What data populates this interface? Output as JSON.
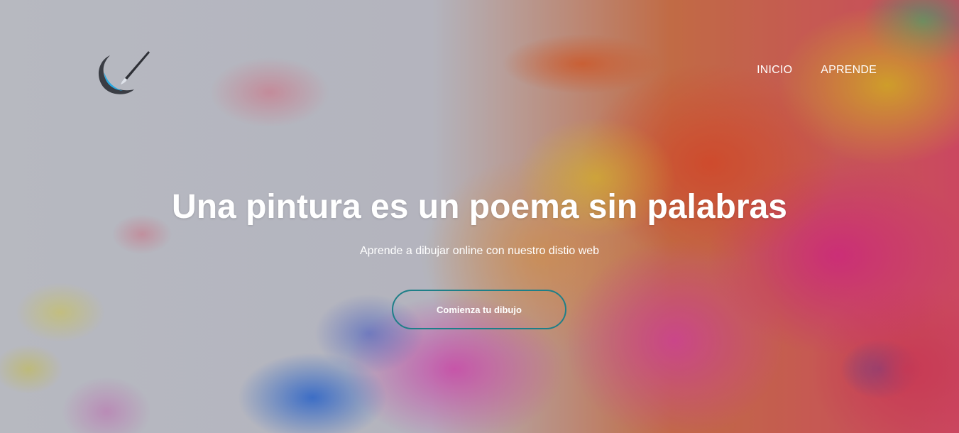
{
  "logo": {
    "icon": "moon-brush-logo-icon",
    "colors": {
      "crescent": "#3a3d44",
      "accent": "#29a9e1",
      "brush": "#2e3036"
    }
  },
  "nav": {
    "items": [
      {
        "label": "INICIO"
      },
      {
        "label": "APRENDE"
      }
    ]
  },
  "hero": {
    "headline": "Una pintura es un poema sin palabras",
    "subtitle": "Aprende a dibujar online con nuestro distio web",
    "cta_label": "Comienza tu dibujo"
  },
  "theme": {
    "text": "#ffffff",
    "cta_border": "#1e7f88"
  }
}
